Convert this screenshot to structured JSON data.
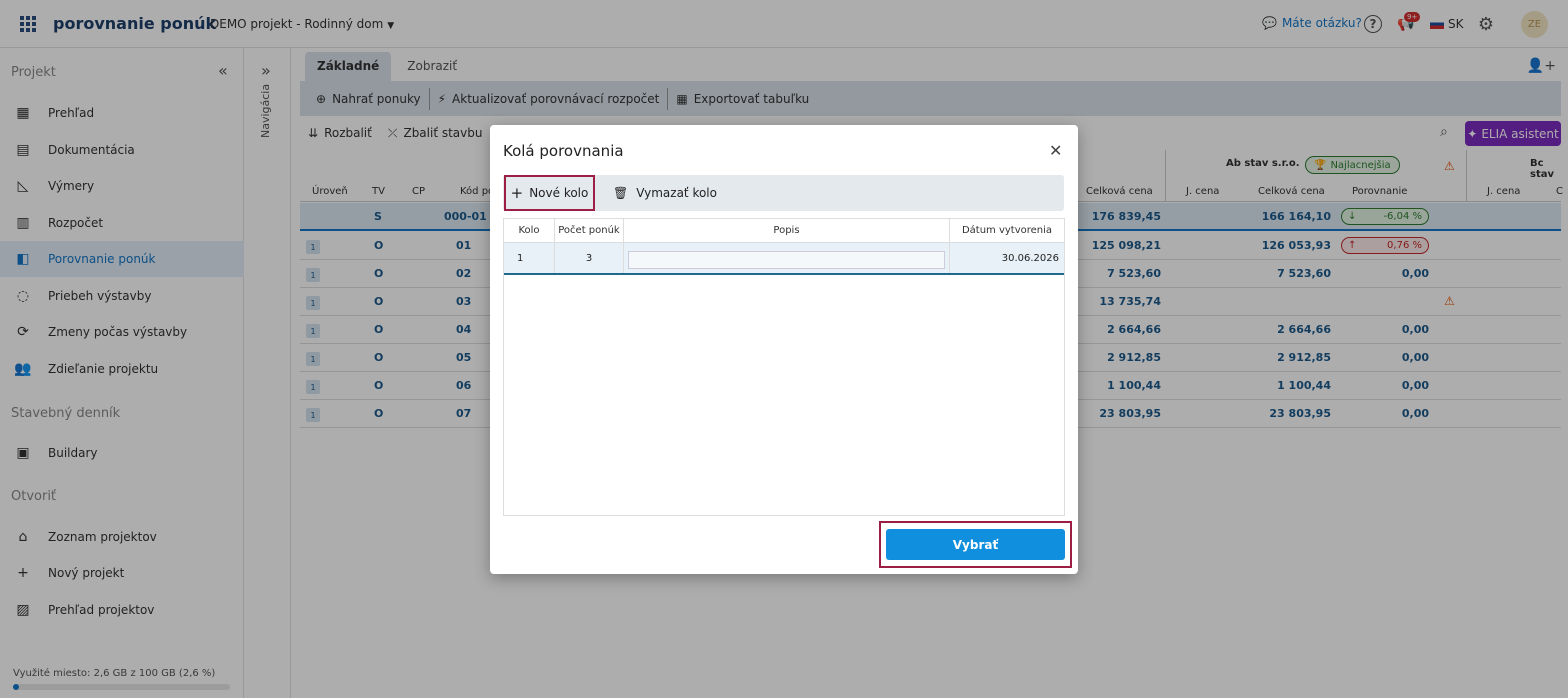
{
  "topbar": {
    "brand": "porovnanie ponúk",
    "project": "DEMO projekt - Rodinný dom",
    "help_link": "Máte otázku?",
    "notification_badge": "9+",
    "language": "SK",
    "avatar": "ZE"
  },
  "sidebar": {
    "section_project": "Projekt",
    "section_diary": "Stavebný denník",
    "section_open": "Otvoriť",
    "items": [
      {
        "label": "Prehľad",
        "icon": "dashboard-icon"
      },
      {
        "label": "Dokumentácia",
        "icon": "document-icon"
      },
      {
        "label": "Výmery",
        "icon": "measure-icon"
      },
      {
        "label": "Rozpočet",
        "icon": "budget-icon"
      },
      {
        "label": "Porovnanie ponúk",
        "icon": "compare-icon"
      },
      {
        "label": "Priebeh výstavby",
        "icon": "progress-icon"
      },
      {
        "label": "Zmeny počas výstavby",
        "icon": "changes-icon"
      },
      {
        "label": "Zdieľanie projektu",
        "icon": "share-icon"
      }
    ],
    "diary_items": [
      {
        "label": "Buildary",
        "icon": "buildary-icon"
      }
    ],
    "open_items": [
      {
        "label": "Zoznam projektov",
        "icon": "home-icon"
      },
      {
        "label": "Nový projekt",
        "icon": "plus-icon"
      },
      {
        "label": "Prehľad projektov",
        "icon": "chart-icon"
      }
    ],
    "storage_text": "Využité miesto: 2,6 GB z 100 GB (2,6 %)",
    "storage_fraction": 0.026
  },
  "navstrip": {
    "label": "Navigácia"
  },
  "main": {
    "tabs": [
      "Základné",
      "Zobraziť"
    ],
    "toolbar": [
      "Nahrať ponuky",
      "Aktualizovať porovnávací rozpočet",
      "Exportovať tabuľku"
    ],
    "toolbar2": [
      "Rozbaliť",
      "Zbaliť stavbu"
    ],
    "elia": "ELIA asistent",
    "table": {
      "headers": [
        "Úroveň",
        "TV",
        "CP",
        "Kód po",
        "Celková cena",
        "J. cena",
        "Celková cena",
        "Porovnanie",
        "J. cena",
        "C"
      ],
      "supplier_a": "Ab stav s.r.o.",
      "supplier_a_badge": "Najlacnejšia",
      "supplier_b": "Bc stav",
      "total_row": {
        "tv": "S",
        "code": "000-01",
        "total": "176 839,45",
        "a_total": "166 164,10",
        "a_cmp": "-6,04 %"
      },
      "rows": [
        {
          "lvl": "1",
          "tv": "O",
          "code": "01",
          "total": "125 098,21",
          "a_total": "126 053,93",
          "a_cmp": "0,76 %"
        },
        {
          "lvl": "1",
          "tv": "O",
          "code": "02",
          "total": "7 523,60",
          "a_total": "7 523,60",
          "a_cmp": "0,00"
        },
        {
          "lvl": "1",
          "tv": "O",
          "code": "03",
          "total": "13 735,74",
          "a_total": "",
          "a_cmp": ""
        },
        {
          "lvl": "1",
          "tv": "O",
          "code": "04",
          "total": "2 664,66",
          "a_total": "2 664,66",
          "a_cmp": "0,00"
        },
        {
          "lvl": "1",
          "tv": "O",
          "code": "05",
          "total": "2 912,85",
          "a_total": "2 912,85",
          "a_cmp": "0,00"
        },
        {
          "lvl": "1",
          "tv": "O",
          "code": "06",
          "total": "1 100,44",
          "a_total": "1 100,44",
          "a_cmp": "0,00"
        },
        {
          "lvl": "1",
          "tv": "O",
          "code": "07",
          "total": "23 803,95",
          "a_total": "23 803,95",
          "a_cmp": "0,00"
        }
      ]
    }
  },
  "modal": {
    "title": "Kolá porovnania",
    "new_round": "Nové kolo",
    "delete_round": "Vymazať kolo",
    "headers": [
      "Kolo",
      "Počet ponúk",
      "Popis",
      "Dátum vytvorenia"
    ],
    "row": {
      "kolo": "1",
      "count": "3",
      "popis": "",
      "date": "30.06.2026"
    },
    "select": "Vybrať"
  },
  "colors": {
    "accent": "#1476c8",
    "highlight": "#9c1e45",
    "elia": "#7b2cbf",
    "select_button": "#0f8fde"
  }
}
